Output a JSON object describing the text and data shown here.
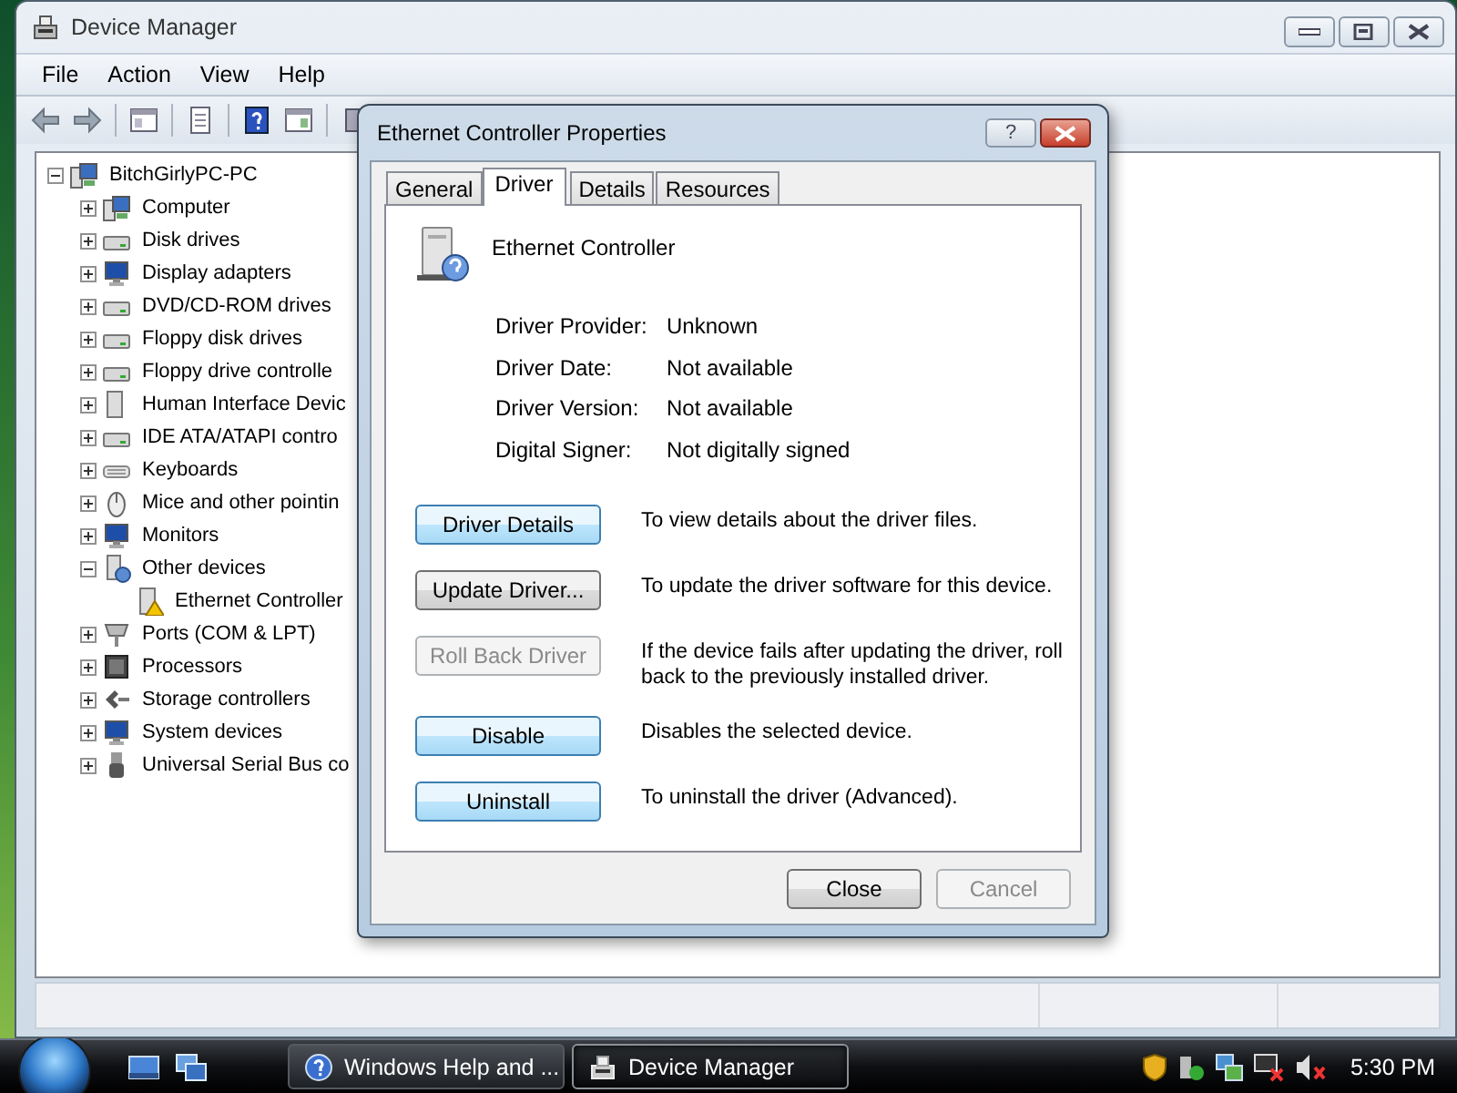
{
  "window": {
    "title": "Device Manager"
  },
  "menu": [
    "File",
    "Action",
    "View",
    "Help"
  ],
  "tree": {
    "label": "BitchGirlyPC-PC",
    "expanded": true,
    "children": [
      {
        "label": "Computer",
        "expanded": false
      },
      {
        "label": "Disk drives",
        "expanded": false
      },
      {
        "label": "Display adapters",
        "expanded": false
      },
      {
        "label": "DVD/CD-ROM drives",
        "expanded": false
      },
      {
        "label": "Floppy disk drives",
        "expanded": false
      },
      {
        "label": "Floppy drive controlle",
        "expanded": false
      },
      {
        "label": "Human Interface Devic",
        "expanded": false
      },
      {
        "label": "IDE ATA/ATAPI contro",
        "expanded": false
      },
      {
        "label": "Keyboards",
        "expanded": false
      },
      {
        "label": "Mice and other pointin",
        "expanded": false
      },
      {
        "label": "Monitors",
        "expanded": false
      },
      {
        "label": "Other devices",
        "expanded": true,
        "children": [
          {
            "label": "Ethernet Controller",
            "warning": true
          }
        ]
      },
      {
        "label": "Ports (COM & LPT)",
        "expanded": false
      },
      {
        "label": "Processors",
        "expanded": false
      },
      {
        "label": "Storage controllers",
        "expanded": false
      },
      {
        "label": "System devices",
        "expanded": false
      },
      {
        "label": "Universal Serial Bus co",
        "expanded": false
      }
    ]
  },
  "dialog": {
    "title": "Ethernet Controller Properties",
    "help_button": "?",
    "tabs": [
      {
        "label": "General",
        "selected": false
      },
      {
        "label": "Driver",
        "selected": true
      },
      {
        "label": "Details",
        "selected": false
      },
      {
        "label": "Resources",
        "selected": false
      }
    ],
    "device_name": "Ethernet Controller",
    "properties": [
      {
        "label": "Driver Provider:",
        "value": "Unknown"
      },
      {
        "label": "Driver Date:",
        "value": "Not available"
      },
      {
        "label": "Driver Version:",
        "value": "Not available"
      },
      {
        "label": "Digital Signer:",
        "value": "Not digitally signed"
      }
    ],
    "actions": [
      {
        "button": "Driver Details",
        "description": "To view details about the driver files.",
        "disabled": false,
        "highlighted": true
      },
      {
        "button": "Update Driver...",
        "description": "To update the driver software for this device.",
        "disabled": false,
        "highlighted": false
      },
      {
        "button": "Roll Back Driver",
        "description": "If the device fails after updating the driver, roll back to the previously installed driver.",
        "disabled": true,
        "highlighted": false
      },
      {
        "button": "Disable",
        "description": "Disables the selected device.",
        "disabled": false,
        "highlighted": true
      },
      {
        "button": "Uninstall",
        "description": "To uninstall the driver (Advanced).",
        "disabled": false,
        "highlighted": true
      }
    ],
    "footer_buttons": [
      {
        "label": "Close",
        "disabled": false
      },
      {
        "label": "Cancel",
        "disabled": true
      }
    ]
  },
  "taskbar": {
    "buttons": [
      {
        "label": "Windows Help and ...",
        "selected": false
      },
      {
        "label": "Device Manager",
        "selected": true
      }
    ],
    "clock": "5:30 PM"
  }
}
